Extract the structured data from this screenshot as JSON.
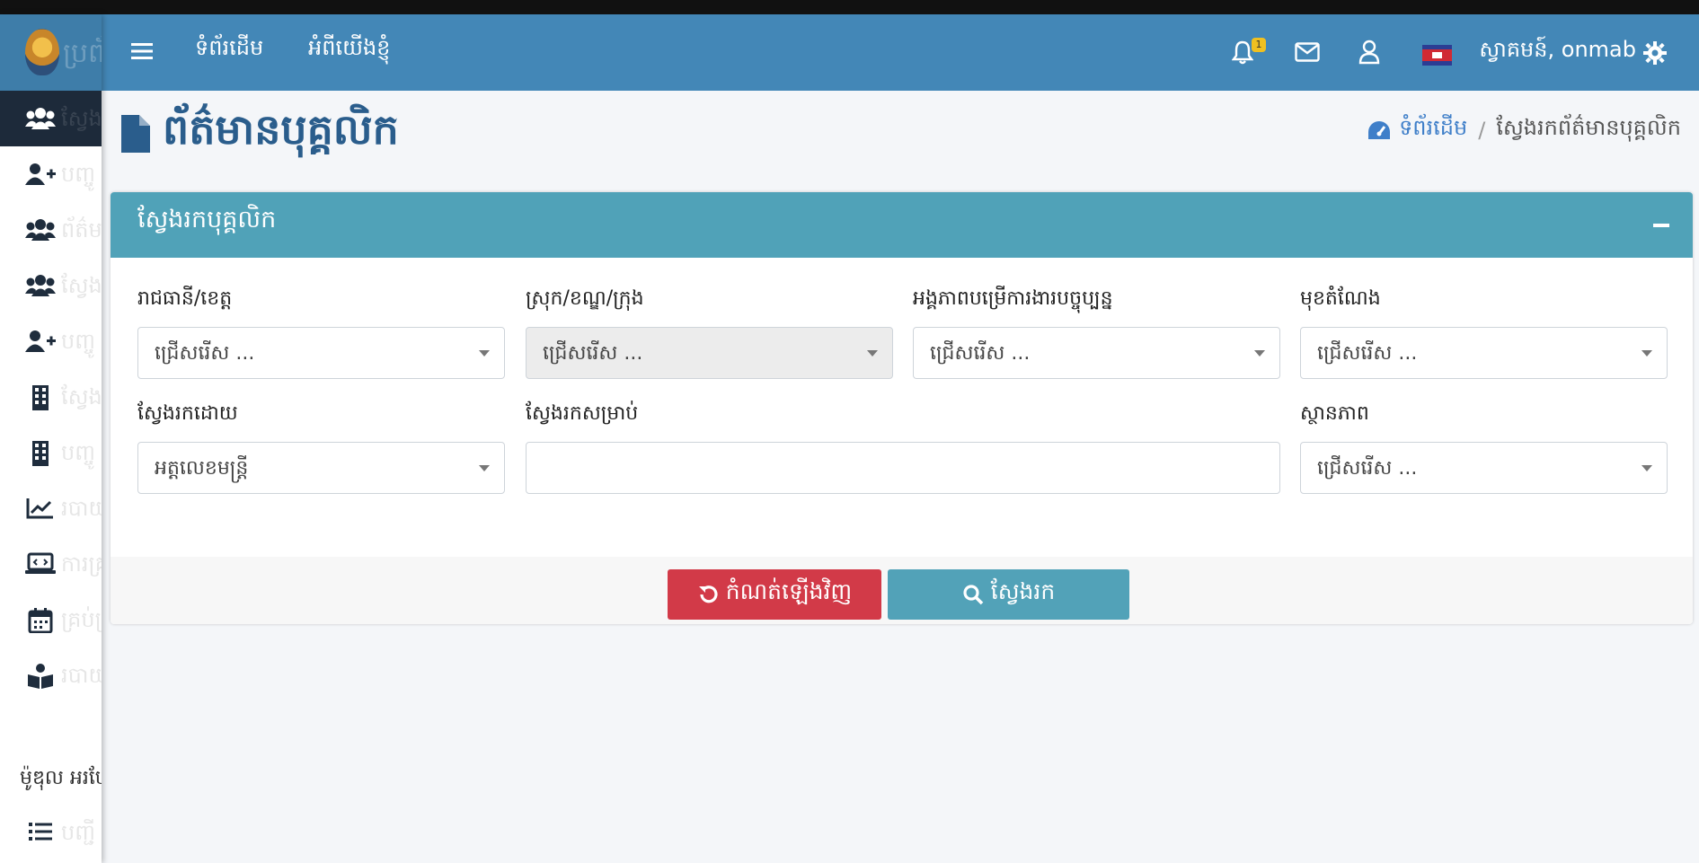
{
  "topbar": {
    "nav_home": "ទំព័រដើម",
    "nav_about": "អំពីយើងខ្ញុំ",
    "notification_count": "1",
    "user_greeting": "ស្វាគមន៍, onmab"
  },
  "sidebar": {
    "ghost_logo": "ប្រព័",
    "items": [
      {
        "icon": "users-icon",
        "ghost": "ស្វែង"
      },
      {
        "icon": "user-plus-icon",
        "ghost": "បញ្ចូ"
      },
      {
        "icon": "users-icon",
        "ghost": "ព័ត៌ម"
      },
      {
        "icon": "users-icon",
        "ghost": "ស្វែង"
      },
      {
        "icon": "user-plus-icon",
        "ghost": "បញ្ចូ"
      },
      {
        "icon": "building-icon",
        "ghost": "ស្វែង"
      },
      {
        "icon": "building-icon",
        "ghost": "បញ្ចូ"
      },
      {
        "icon": "chart-line-icon",
        "ghost": "របាយ"
      },
      {
        "icon": "laptop-code-icon",
        "ghost": "ការគ្រ"
      },
      {
        "icon": "calendar-icon",
        "ghost": "គ្រប់គ្រ"
      },
      {
        "icon": "book-reader-icon",
        "ghost": "របាយ"
      }
    ],
    "section_label": "ម៉ូឌុល អរបែ",
    "list_item_ghost": "បញ្ជី"
  },
  "page": {
    "title": "ព័ត៌មានបុគ្គលិក",
    "breadcrumb_home": "ទំព័រដើម",
    "breadcrumb_current": "ស្វែងរកព័ត៌មានបុគ្គលិក"
  },
  "search_card": {
    "title": "ស្វែងរកបុគ្គលិក",
    "fields": {
      "province_label": "រាជធានី/ខេត្ត",
      "province_value": "ជ្រើសរើស ...",
      "district_label": "ស្រុក/ខណ្ឌ/ក្រុង",
      "district_value": "ជ្រើសរើស ...",
      "unit_label": "អង្គភាពបម្រើការងារបច្ចុប្បន្ន",
      "unit_value": "ជ្រើសរើស ...",
      "position_label": "មុខតំណែង",
      "position_value": "ជ្រើសរើស ...",
      "search_by_label": "ស្វែងរកដោយ",
      "search_by_value": "អត្តលេខមន្ត្រី",
      "search_for_label": "ស្វែងរកសម្រាប់",
      "search_for_value": "",
      "status_label": "ស្ថានភាព",
      "status_value": "ជ្រើសរើស ..."
    },
    "reset_button": "កំណត់ឡើងវិញ",
    "search_button": "ស្វែងរក"
  }
}
